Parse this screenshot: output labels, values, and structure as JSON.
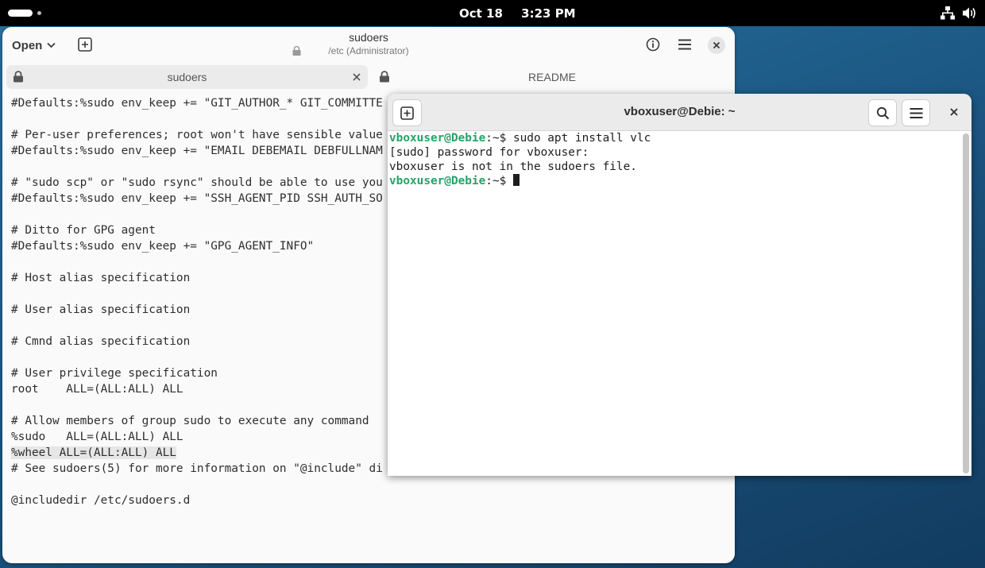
{
  "topbar": {
    "date": "Oct 18",
    "time": "3:23 PM",
    "icons": [
      "activities-indicator",
      "network-icon",
      "volume-icon"
    ]
  },
  "editor": {
    "open_label": "Open",
    "title": "sudoers",
    "subtitle": "/etc (Administrator)",
    "tabs": [
      {
        "label": "sudoers"
      },
      {
        "label": "README"
      }
    ],
    "lines": [
      "#Defaults:%sudo env_keep += \"GIT_AUTHOR_* GIT_COMMITTE",
      "",
      "# Per-user preferences; root won't have sensible value",
      "#Defaults:%sudo env_keep += \"EMAIL DEBEMAIL DEBFULLNAM",
      "",
      "# \"sudo scp\" or \"sudo rsync\" should be able to use you",
      "#Defaults:%sudo env_keep += \"SSH_AGENT_PID SSH_AUTH_SO",
      "",
      "# Ditto for GPG agent",
      "#Defaults:%sudo env_keep += \"GPG_AGENT_INFO\"",
      "",
      "# Host alias specification",
      "",
      "# User alias specification",
      "",
      "# Cmnd alias specification",
      "",
      "# User privilege specification",
      "root    ALL=(ALL:ALL) ALL",
      "",
      "# Allow members of group sudo to execute any command",
      "%sudo   ALL=(ALL:ALL) ALL",
      "%wheel ALL=(ALL:ALL) ALL",
      "# See sudoers(5) for more information on \"@include\" di",
      "",
      "@includedir /etc/sudoers.d"
    ]
  },
  "terminal": {
    "title": "vboxuser@Debie: ~",
    "prompt_user": "vboxuser@Debie",
    "prompt_path": ":~$ ",
    "command": "sudo apt install vlc",
    "output_1": "[sudo] password for vboxuser:",
    "output_2": "vboxuser is not in the sudoers file."
  },
  "colors": {
    "prompt_green": "#26a269",
    "topbar": "#000000",
    "desktop": "#1f5f8c"
  }
}
